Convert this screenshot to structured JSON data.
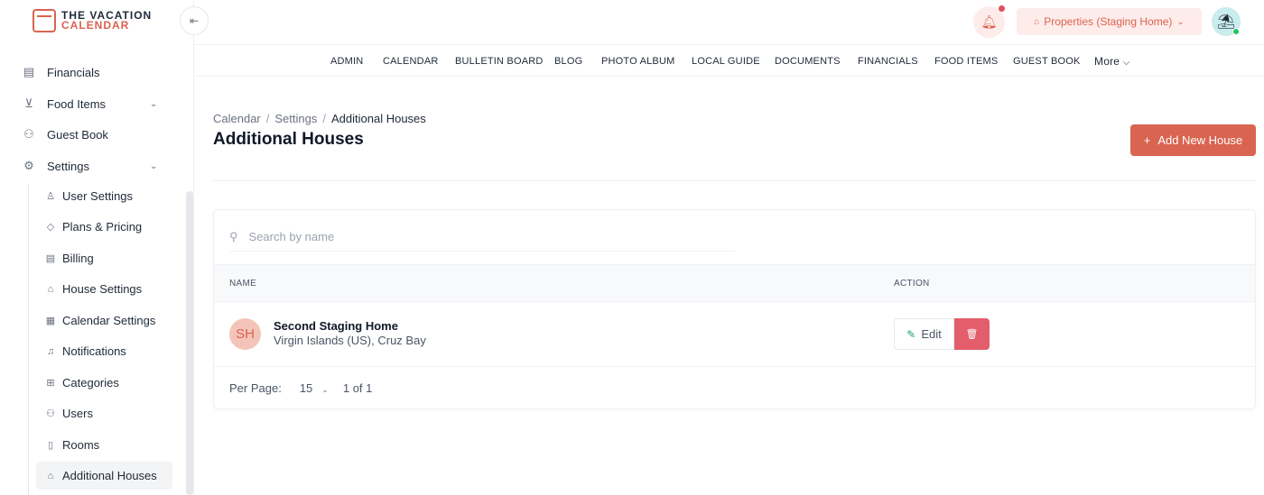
{
  "brand": {
    "line1": "THE VACATION",
    "line2": "CALENDAR"
  },
  "sidebar": {
    "items": [
      {
        "label": "Financials",
        "icon": "financials-icon"
      },
      {
        "label": "Food Items",
        "icon": "food-icon",
        "chevron": "⌄"
      },
      {
        "label": "Guest Book",
        "icon": "guestbook-icon"
      },
      {
        "label": "Settings",
        "icon": "gear-icon",
        "chevron": "⌄"
      }
    ],
    "sub_items": [
      {
        "label": "User Settings",
        "icon": "user-icon"
      },
      {
        "label": "Plans & Pricing",
        "icon": "tag-icon"
      },
      {
        "label": "Billing",
        "icon": "billing-icon"
      },
      {
        "label": "House Settings",
        "icon": "house-icon"
      },
      {
        "label": "Calendar Settings",
        "icon": "calendar-icon"
      },
      {
        "label": "Notifications",
        "icon": "bell-icon"
      },
      {
        "label": "Categories",
        "icon": "grid-icon"
      },
      {
        "label": "Users",
        "icon": "users-icon"
      },
      {
        "label": "Rooms",
        "icon": "door-icon"
      },
      {
        "label": "Additional Houses",
        "icon": "house-icon"
      }
    ]
  },
  "topbar": {
    "collapse_icon": "⇤",
    "property_label": "Properties (Staging Home)",
    "property_chevron": "⌄"
  },
  "menu": {
    "items": [
      "ADMIN",
      "CALENDAR",
      "BULLETIN BOARD",
      "BLOG",
      "PHOTO ALBUM",
      "LOCAL GUIDE",
      "DOCUMENTS",
      "FINANCIALS",
      "FOOD ITEMS",
      "GUEST BOOK"
    ],
    "more": "More"
  },
  "breadcrumb": {
    "items": [
      "Calendar",
      "Settings",
      "Additional Houses"
    ],
    "sep": "/"
  },
  "page": {
    "title": "Additional Houses",
    "add_button": "Add New House",
    "add_plus": "+"
  },
  "search": {
    "placeholder": "Search by name",
    "value": ""
  },
  "table": {
    "columns": [
      "NAME",
      "ACTION"
    ],
    "rows": [
      {
        "initials": "SH",
        "name": "Second Staging Home",
        "location": "Virgin Islands (US), Cruz Bay",
        "edit": "Edit"
      }
    ]
  },
  "pagination": {
    "label": "Per Page:",
    "per_page": "15",
    "chevron": "⌄",
    "page": "1",
    "of": "of",
    "total": "1"
  },
  "colors": {
    "accent": "#d96450",
    "accent_soft": "#fdecea",
    "danger": "#e35d6a",
    "online": "#22c55e"
  }
}
